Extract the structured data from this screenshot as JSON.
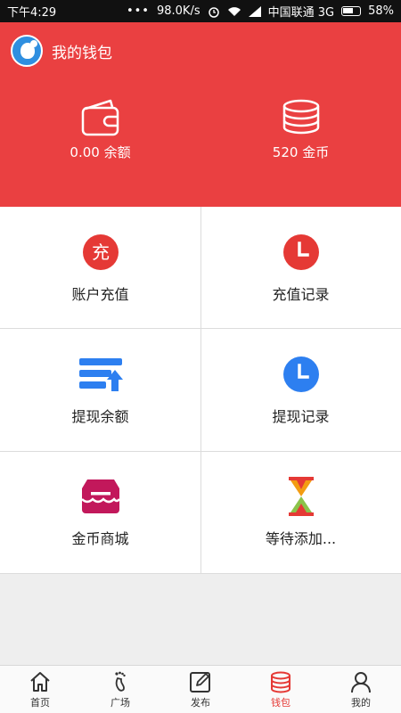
{
  "status_bar": {
    "time": "下午4:29",
    "speed": "98.0K/s",
    "carrier": "中国联通 3G",
    "battery": "58%"
  },
  "header": {
    "title": "我的钱包",
    "balance_label": "0.00 余额",
    "coins_label": "520 金币",
    "color": "#ea4041"
  },
  "grid": {
    "items": [
      {
        "label": "账户充值",
        "icon": "recharge-icon",
        "glyph": "充",
        "color": "#e53935"
      },
      {
        "label": "充值记录",
        "icon": "clock-icon",
        "color": "#e53935"
      },
      {
        "label": "提现余额",
        "icon": "withdraw-icon",
        "color": "#2d7ff0"
      },
      {
        "label": "提现记录",
        "icon": "clock-icon",
        "color": "#2d7ff0"
      },
      {
        "label": "金币商城",
        "icon": "store-icon",
        "color": "#c2185b"
      },
      {
        "label": "等待添加...",
        "icon": "hourglass-icon",
        "color": "#e53935"
      }
    ]
  },
  "tabbar": {
    "tabs": [
      {
        "label": "首页",
        "icon": "home-icon"
      },
      {
        "label": "广场",
        "icon": "footprint-icon"
      },
      {
        "label": "发布",
        "icon": "edit-icon"
      },
      {
        "label": "钱包",
        "icon": "coins-icon",
        "active": true
      },
      {
        "label": "我的",
        "icon": "user-icon"
      }
    ]
  }
}
